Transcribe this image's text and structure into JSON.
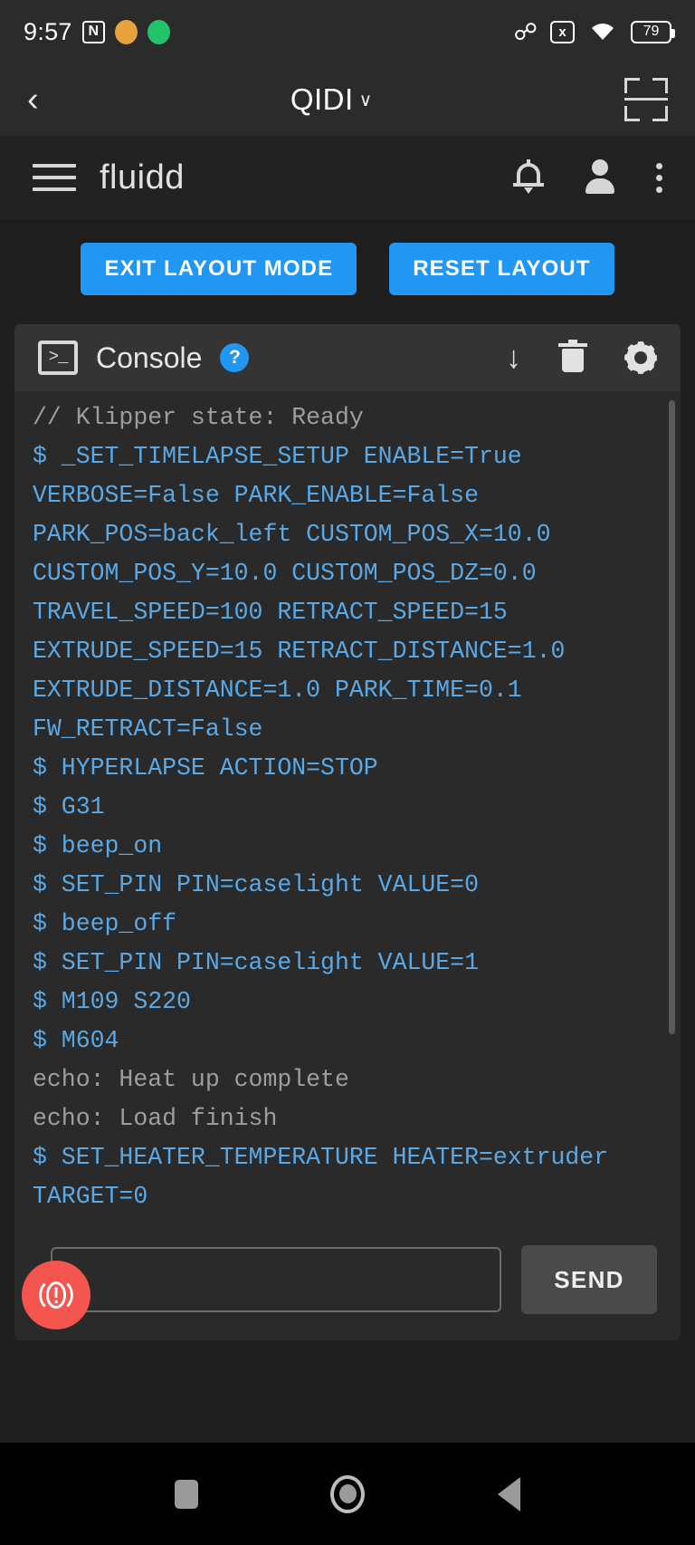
{
  "status_bar": {
    "time": "9:57",
    "nfc_label": "N",
    "badge1_color": "#e8a33d",
    "badge2_color": "#23c36b",
    "badge1_glyph": "✎",
    "badge2_glyph": "⬤",
    "bluetooth_glyph": "ᛗ",
    "no_sim_label": "x",
    "battery_level": "79"
  },
  "app_bar": {
    "back_glyph": "‹",
    "title": "QIDI",
    "caret_glyph": "∨",
    "scan_icon": "fullscreen-scan-icon"
  },
  "fluidd_bar": {
    "menu_icon": "hamburger-menu-icon",
    "brand": "fluidd",
    "bell_icon": "notification-bell-icon",
    "account_icon": "account-person-icon",
    "overflow_icon": "kebab-menu-icon"
  },
  "layout_mode": {
    "exit_label": "EXIT LAYOUT MODE",
    "reset_label": "RESET LAYOUT",
    "accent_color": "#2196f3"
  },
  "console": {
    "icon": "terminal-icon",
    "icon_glyph": ">_",
    "title": "Console",
    "help_badge": "?",
    "scroll_bottom_icon": "arrow-down-icon",
    "scroll_bottom_glyph": "↓",
    "clear_icon": "trash-icon",
    "settings_icon": "gear-icon",
    "lines": [
      {
        "type": "echo",
        "text": "// Klipper state: Ready"
      },
      {
        "type": "cmd",
        "text": "$ _SET_TIMELAPSE_SETUP ENABLE=True VERBOSE=False PARK_ENABLE=False PARK_POS=back_left CUSTOM_POS_X=10.0 CUSTOM_POS_Y=10.0 CUSTOM_POS_DZ=0.0 TRAVEL_SPEED=100 RETRACT_SPEED=15 EXTRUDE_SPEED=15 RETRACT_DISTANCE=1.0 EXTRUDE_DISTANCE=1.0 PARK_TIME=0.1 FW_RETRACT=False"
      },
      {
        "type": "cmd",
        "text": "$ HYPERLAPSE ACTION=STOP"
      },
      {
        "type": "cmd",
        "text": "$ G31"
      },
      {
        "type": "cmd",
        "text": "$ beep_on"
      },
      {
        "type": "cmd",
        "text": "$ SET_PIN PIN=caselight VALUE=0"
      },
      {
        "type": "cmd",
        "text": "$ beep_off"
      },
      {
        "type": "cmd",
        "text": "$ SET_PIN PIN=caselight VALUE=1"
      },
      {
        "type": "cmd",
        "text": "$ M109 S220"
      },
      {
        "type": "cmd",
        "text": "$ M604"
      },
      {
        "type": "echo",
        "text": "echo: Heat up complete"
      },
      {
        "type": "echo",
        "text": "echo: Load finish"
      },
      {
        "type": "cmd",
        "text": "$ SET_HEATER_TEMPERATURE HEATER=extruder TARGET=0"
      }
    ],
    "input_value": "",
    "input_placeholder": "",
    "send_label": "SEND",
    "cmd_color": "#5aa9e6",
    "echo_color": "#9e9e9e"
  },
  "emergency_stop": {
    "name": "emergency-stop-button",
    "color": "#f4554f"
  },
  "nav_bar": {
    "recents_icon": "recents-square-icon",
    "home_icon": "home-circle-icon",
    "back_icon": "back-triangle-icon"
  }
}
